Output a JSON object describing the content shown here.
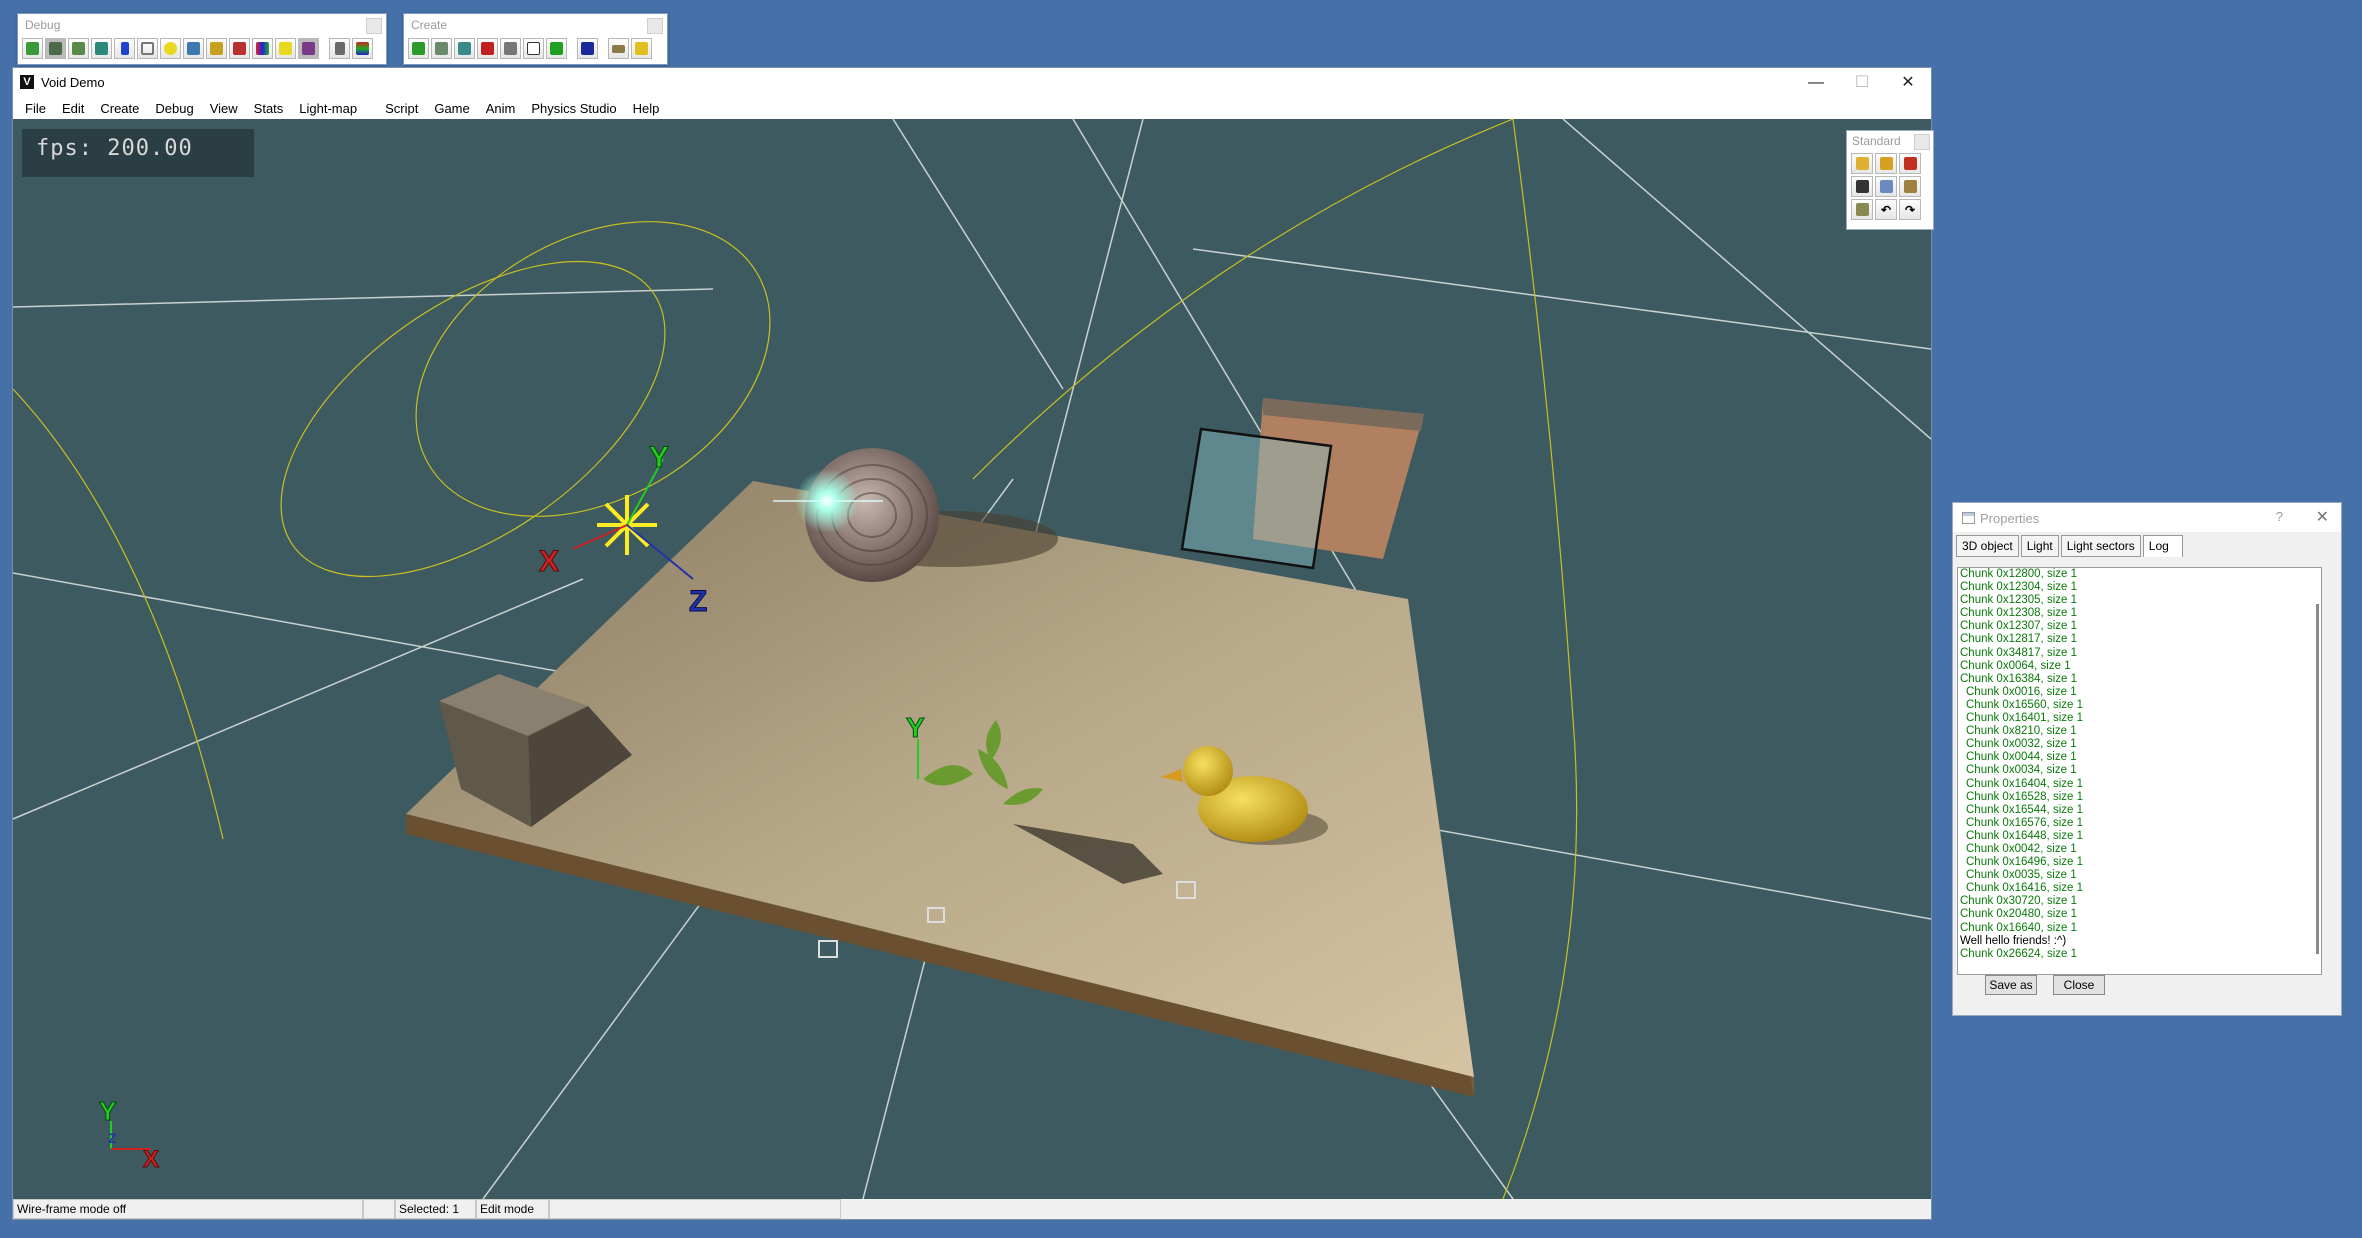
{
  "debug_toolbar": {
    "title": "Debug"
  },
  "create_toolbar": {
    "title": "Create"
  },
  "window": {
    "title": "Void Demo",
    "minimize": "—",
    "maximize": "☐",
    "close": "✕",
    "menus": [
      "File",
      "Edit",
      "Create",
      "Debug",
      "View",
      "Stats",
      "Light-map",
      "Script",
      "Game",
      "Anim",
      "Physics Studio",
      "Help"
    ]
  },
  "viewport": {
    "fps": "fps: 200.00"
  },
  "gizmo": {
    "y": "Y",
    "x": "X",
    "z": "Z",
    "plant_y": "Y"
  },
  "status": {
    "wireframe": "Wire-frame mode off",
    "selected": "Selected: 1",
    "mode": "Edit mode"
  },
  "standard_toolbar": {
    "title": "Standard"
  },
  "properties": {
    "title": "Properties",
    "help": "?",
    "close": "✕",
    "tabs": [
      "3D object",
      "Light",
      "Light sectors",
      "Log"
    ],
    "active_tab": "Log",
    "log": [
      {
        "text": "Chunk 0x12800, size 1",
        "indent": false
      },
      {
        "text": "Chunk 0x12304, size 1",
        "indent": false
      },
      {
        "text": "Chunk 0x12305, size 1",
        "indent": false
      },
      {
        "text": "Chunk 0x12308, size 1",
        "indent": false
      },
      {
        "text": "Chunk 0x12307, size 1",
        "indent": false
      },
      {
        "text": "Chunk 0x12817, size 1",
        "indent": false
      },
      {
        "text": "Chunk 0x34817, size 1",
        "indent": false
      },
      {
        "text": "Chunk 0x0064, size 1",
        "indent": false
      },
      {
        "text": "Chunk 0x16384, size 1",
        "indent": false
      },
      {
        "text": "Chunk 0x0016, size 1",
        "indent": true
      },
      {
        "text": "Chunk 0x16560, size 1",
        "indent": true
      },
      {
        "text": "Chunk 0x16401, size 1",
        "indent": true
      },
      {
        "text": "Chunk 0x8210, size 1",
        "indent": true
      },
      {
        "text": "Chunk 0x0032, size 1",
        "indent": true
      },
      {
        "text": "Chunk 0x0044, size 1",
        "indent": true
      },
      {
        "text": "Chunk 0x0034, size 1",
        "indent": true
      },
      {
        "text": "Chunk 0x16404, size 1",
        "indent": true
      },
      {
        "text": "Chunk 0x16528, size 1",
        "indent": true
      },
      {
        "text": "Chunk 0x16544, size 1",
        "indent": true
      },
      {
        "text": "Chunk 0x16576, size 1",
        "indent": true
      },
      {
        "text": "Chunk 0x16448, size 1",
        "indent": true
      },
      {
        "text": "Chunk 0x0042, size 1",
        "indent": true
      },
      {
        "text": "Chunk 0x16496, size 1",
        "indent": true
      },
      {
        "text": "Chunk 0x0035, size 1",
        "indent": true
      },
      {
        "text": "Chunk 0x16416, size 1",
        "indent": true
      },
      {
        "text": "Chunk 0x30720, size 1",
        "indent": false
      },
      {
        "text": "Chunk 0x20480, size 1",
        "indent": false
      },
      {
        "text": "Chunk 0x16640, size 1",
        "indent": false
      },
      {
        "text": "Well hello friends! :^)",
        "indent": false,
        "black": true
      },
      {
        "text": "Chunk 0x26624, size 1",
        "indent": false
      }
    ],
    "save_as": "Save as",
    "close_button": "Close"
  },
  "colors": {
    "desktop": "#4671a8",
    "viewport": "#3d5a60",
    "log_text": "#0a7a0a",
    "gizmo_y": "#22cc22",
    "gizmo_x": "#cc2222",
    "gizmo_z": "#2233aa"
  }
}
